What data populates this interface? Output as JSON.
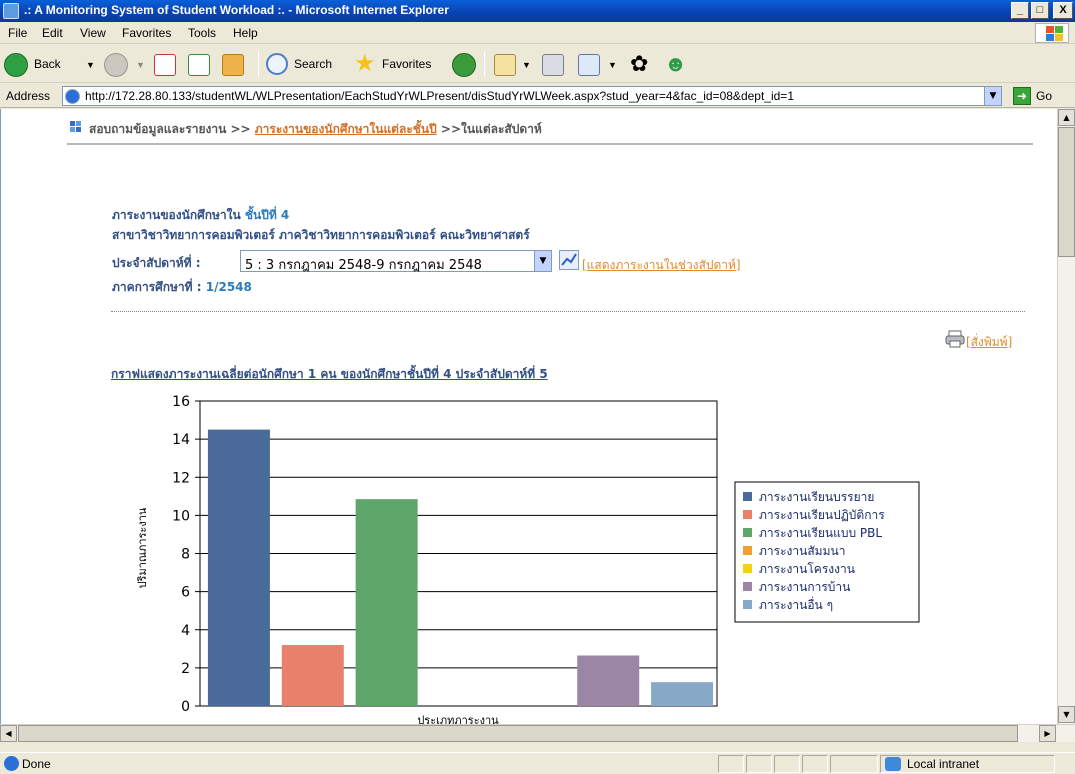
{
  "window": {
    "title": ".: A Monitoring System of Student Workload :. - Microsoft Internet Explorer",
    "buttons": {
      "minimize": "_",
      "maximize": "□",
      "close": "X"
    }
  },
  "menu": [
    "File",
    "Edit",
    "View",
    "Favorites",
    "Tools",
    "Help"
  ],
  "toolbar": {
    "back": "Back",
    "search": "Search",
    "favorites": "Favorites"
  },
  "address": {
    "label": "Address",
    "url": "http://172.28.80.133/studentWL/WLPresentation/EachStudYrWLPresent/disStudYrWLWeek.aspx?stud_year=4&fac_id=08&dept_id=1",
    "go": "Go"
  },
  "page": {
    "breadcrumb": {
      "root": "สอบถามข้อมูลและรายงาน >>",
      "link": "ภาระงานของนักศึกษาในแต่ละชั้นปี",
      "current": ">>ในแต่ละสัปดาห์"
    },
    "info": {
      "year_label": "ภาระงานของนักศึกษาใน",
      "year_value": "ชั้นปีที่ 4",
      "department": "สาขาวิชาวิทยาการคอมพิวเตอร์  ภาควิชาวิทยาการคอมพิวเตอร์  คณะวิทยาศาสตร์",
      "week_label": "ประจำสัปดาห์ที่ :",
      "week_selected": "5 : 3 กรกฎาคม 2548-9 กรกฎาคม 2548",
      "range_link": "[แสดงภาระงานในช่วงสัปดาห์]",
      "semester_label": "ภาคการศึกษาที่  :",
      "semester_value": "1/2548"
    },
    "print_link": "[สั่งพิมพ์]",
    "chart_heading": "กราฟแสดงภาระงานเฉลี่ยต่อนักศึกษา 1 คน ของนักศึกษาชั้นปีที่ 4 ประจำสัปดาห์ที่ 5"
  },
  "chart_data": {
    "type": "bar",
    "ylabel": "ปริมาณภาระงาน",
    "xlabel": "ประเภทภาระงาน",
    "ylim": [
      0,
      16
    ],
    "yticks": [
      0,
      2,
      4,
      6,
      8,
      10,
      12,
      14,
      16
    ],
    "grid": true,
    "legend_position": "right",
    "series": [
      {
        "name": "ภาระงานเรียนบรรยาย",
        "value": 14.5,
        "color": "#4a6a9c"
      },
      {
        "name": "ภาระงานเรียนปฏิบัติการ",
        "value": 3.2,
        "color": "#e8806b"
      },
      {
        "name": "ภาระงานเรียนแบบ PBL",
        "value": 10.85,
        "color": "#5fa66a"
      },
      {
        "name": "ภาระงานสัมมนา",
        "value": 0,
        "color": "#f0a030"
      },
      {
        "name": "ภาระงานโครงงาน",
        "value": 0,
        "color": "#f2d11a"
      },
      {
        "name": "ภาระงานการบ้าน",
        "value": 2.65,
        "color": "#9b87a5"
      },
      {
        "name": "ภาระงานอื่น ๆ",
        "value": 1.25,
        "color": "#88a8c8"
      }
    ]
  },
  "status": {
    "text": "Done",
    "zone": "Local intranet"
  }
}
